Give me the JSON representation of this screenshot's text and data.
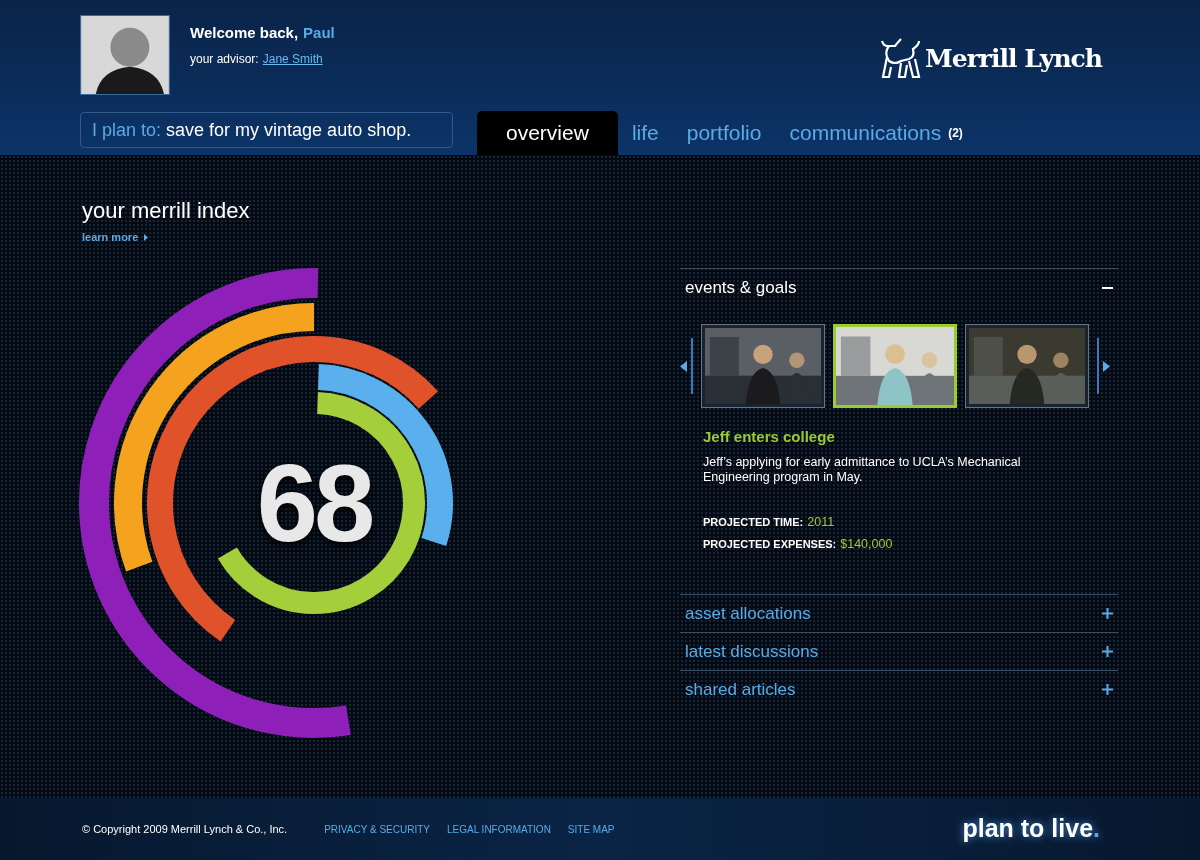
{
  "user": {
    "greeting": "Welcome back,",
    "name": "Paul",
    "advisor_label": "your advisor:",
    "advisor": "Jane Smith"
  },
  "logo": {
    "text": "Merrill Lynch"
  },
  "plan": {
    "label": "I plan to:",
    "value": "save for my vintage auto shop."
  },
  "tabs": [
    {
      "label": "overview",
      "selected": true
    },
    {
      "label": "life",
      "selected": false
    },
    {
      "label": "portfolio",
      "selected": false
    },
    {
      "label": "communications",
      "selected": false,
      "badge": "(2)"
    }
  ],
  "index": {
    "title": "your merrill index",
    "link": "learn more",
    "score": "68"
  },
  "sections": [
    {
      "title": "events & goals",
      "expanded": true
    },
    {
      "title": "asset allocations",
      "expanded": false
    },
    {
      "title": "latest discussions",
      "expanded": false
    },
    {
      "title": "shared articles",
      "expanded": false
    }
  ],
  "events": {
    "thumbnails": [
      {
        "kind": "picture",
        "selected": false
      },
      {
        "kind": "picture",
        "selected": true
      },
      {
        "kind": "picture",
        "selected": false
      }
    ],
    "title": "Jeff enters college",
    "description": "Jeff’s applying for early admittance to UCLA’s Mechanical Engineering program in May.",
    "stats": [
      {
        "label": "PROJECTED TIME:",
        "value": "2011"
      },
      {
        "label": "PROJECTED EXPENSES:",
        "value": "$140,000"
      }
    ]
  },
  "footer": {
    "copyright": "© Copyright 2009 Merrill Lynch & Co., Inc.",
    "links": [
      "PRIVACY & SECURITY",
      "LEGAL INFORMATION",
      "SITE MAP"
    ],
    "tagline": "plan to live",
    "tagline_dot": "."
  }
}
